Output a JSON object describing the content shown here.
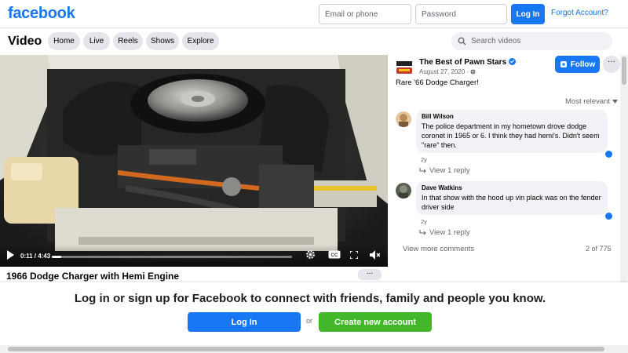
{
  "header": {
    "logo": "facebook",
    "email_placeholder": "Email or phone",
    "password_placeholder": "Password",
    "login_label": "Log In",
    "forgot_label": "Forgot Account?"
  },
  "video_nav": {
    "title": "Video",
    "tabs": [
      {
        "label": "Home"
      },
      {
        "label": "Live"
      },
      {
        "label": "Reels"
      },
      {
        "label": "Shows"
      },
      {
        "label": "Explore"
      }
    ],
    "search_placeholder": "Search videos"
  },
  "player": {
    "time": "0:11 / 4:43",
    "progress": 0.04,
    "post_title": "1966 Dodge Charger with Hemi Engine",
    "more_label": "..."
  },
  "post": {
    "page_name": "The Best of Pawn Stars",
    "date": "August 27, 2020 ·",
    "follow_label": "Follow",
    "more_label": "···",
    "caption": "Rare '66 Dodge Charger!",
    "sort_label": "Most relevant"
  },
  "comments": [
    {
      "name": "Bill Wilson",
      "text": "The police department in my hometown drove dodge coronet in 1965 or 6. I think they had hemi's. Didn't seem \"rare\" then.",
      "age": "2y",
      "reply_label": "View 1 reply"
    },
    {
      "name": "Dave Watkins",
      "text": "In that show with the hood up vin plack was on the fender driver side",
      "age": "2y",
      "reply_label": "View 1 reply"
    }
  ],
  "comments_footer": {
    "view_more": "View more comments",
    "count": "2 of 775"
  },
  "login_banner": {
    "text": "Log in or sign up for Facebook to connect with friends, family and people you know.",
    "login_label": "Log In",
    "or_label": "or",
    "create_label": "Create new account"
  },
  "colors": {
    "brand": "#1877f2",
    "create_green": "#42b72a"
  }
}
